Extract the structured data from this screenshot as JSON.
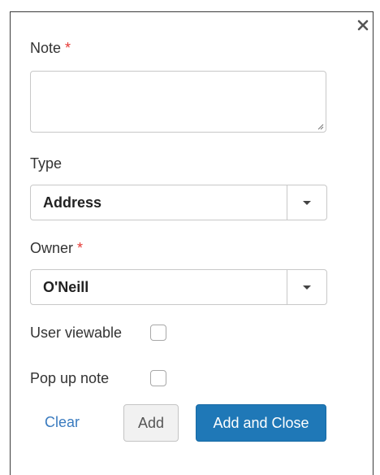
{
  "dialog": {
    "close_symbol": "×",
    "note": {
      "label": "Note",
      "required_mark": "*",
      "value": ""
    },
    "type": {
      "label": "Type",
      "selected": "Address"
    },
    "owner": {
      "label": "Owner",
      "required_mark": "*",
      "selected": "O'Neill"
    },
    "user_viewable": {
      "label": "User viewable",
      "checked": false
    },
    "pop_up_note": {
      "label": "Pop up note",
      "checked": false
    },
    "buttons": {
      "clear": "Clear",
      "add": "Add",
      "add_and_close": "Add and Close"
    }
  },
  "colors": {
    "primary": "#1f78b7",
    "link": "#3a7bbf",
    "required": "#e53935"
  },
  "icons": {
    "close": "close-icon",
    "dropdown": "chevron-down-icon",
    "resize": "resize-grip-icon"
  }
}
